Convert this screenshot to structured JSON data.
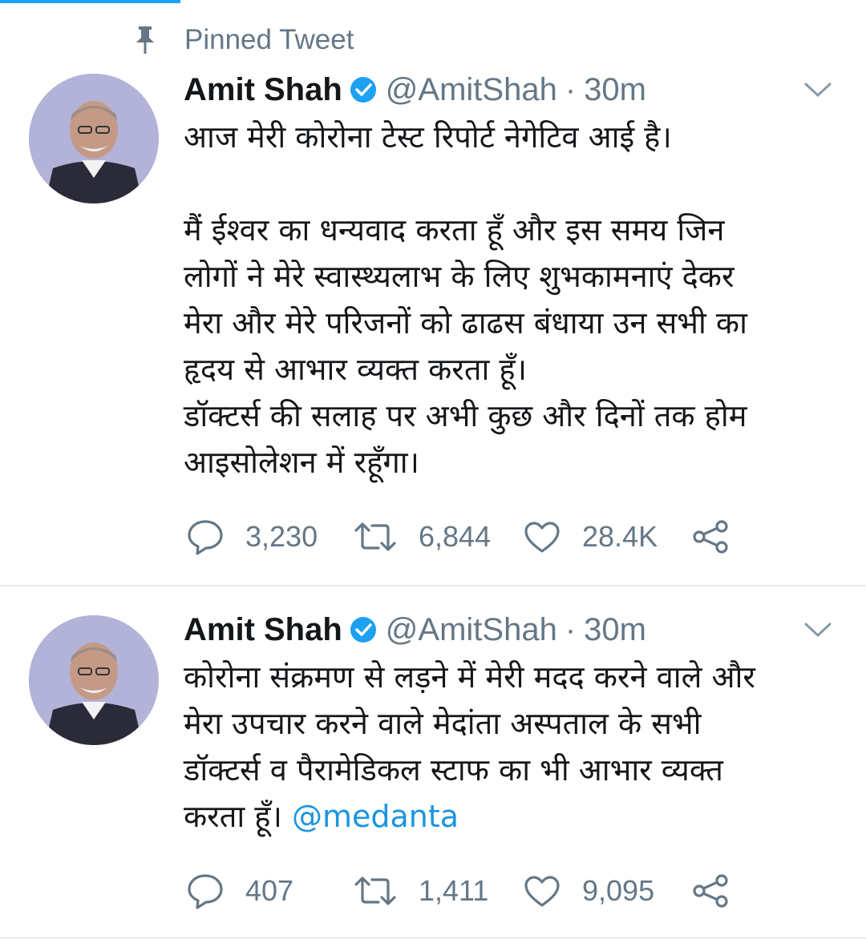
{
  "pinned": {
    "label": "Pinned Tweet",
    "icon": "pin-icon"
  },
  "colors": {
    "accent": "#1da1f2",
    "link": "#1b95e0",
    "muted": "#657786",
    "text": "#14171a",
    "verified": "#1da1f2"
  },
  "tweets": [
    {
      "name": "Amit Shah",
      "handle": "@AmitShah",
      "separator": "·",
      "time": "30m",
      "lines": [
        "आज मेरी कोरोना टेस्ट रिपोर्ट नेगेटिव आई है।",
        "",
        "मैं ईश्वर का धन्यवाद करता हूँ और इस समय जिन",
        "लोगों ने मेरे स्वास्थ्यलाभ के लिए शुभकामनाएं देकर",
        "मेरा और मेरे परिजनों को ढाढस बंधाया उन सभी का",
        "हृदय से आभार व्यक्त करता हूँ।",
        "डॉक्टर्स की सलाह पर अभी कुछ और दिनों तक होम",
        "आइसोलेशन में रहूँगा।"
      ],
      "replies": "3,230",
      "retweets": "6,844",
      "likes": "28.4K"
    },
    {
      "name": "Amit Shah",
      "handle": "@AmitShah",
      "separator": "·",
      "time": "30m",
      "lines": [
        "कोरोना संक्रमण से लड़ने में मेरी मदद करने वाले और",
        "मेरा उपचार करने वाले मेदांता अस्पताल के सभी",
        "डॉक्टर्स व पैरामेडिकल स्टाफ का भी आभार व्यक्त"
      ],
      "last_line_text": "करता हूँ।",
      "mention": "@medanta",
      "replies": "407",
      "retweets": "1,411",
      "likes": "9,095"
    }
  ]
}
